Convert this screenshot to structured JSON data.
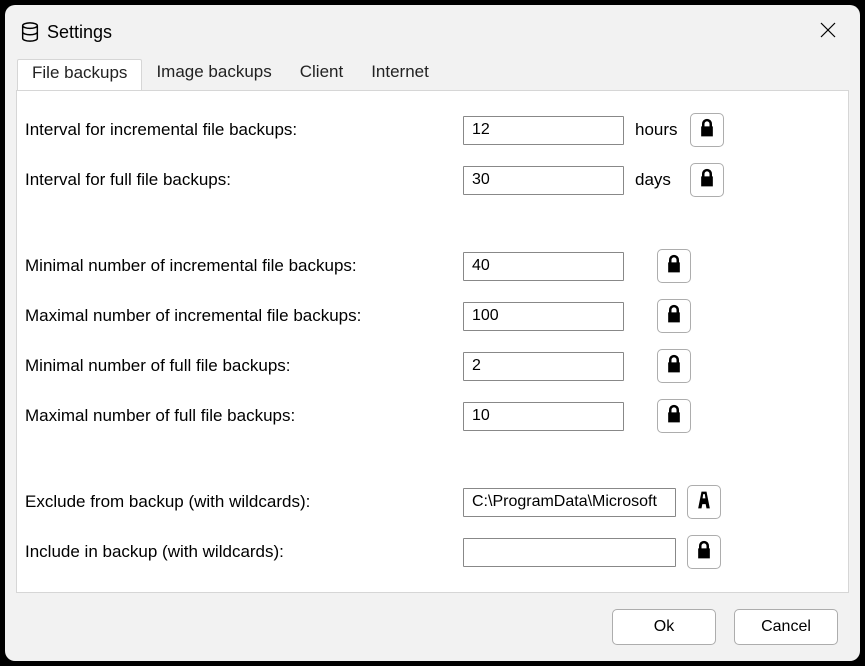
{
  "window": {
    "title": "Settings"
  },
  "tabs": {
    "file_backups": "File backups",
    "image_backups": "Image backups",
    "client": "Client",
    "internet": "Internet"
  },
  "fields": {
    "interval_incremental": {
      "label": "Interval for incremental file backups:",
      "value": "12",
      "unit": "hours"
    },
    "interval_full": {
      "label": "Interval for full file backups:",
      "value": "30",
      "unit": "days"
    },
    "min_incremental": {
      "label": "Minimal number of incremental file backups:",
      "value": "40"
    },
    "max_incremental": {
      "label": "Maximal number of incremental file backups:",
      "value": "100"
    },
    "min_full": {
      "label": "Minimal number of full file backups:",
      "value": "2"
    },
    "max_full": {
      "label": "Maximal number of full file backups:",
      "value": "10"
    },
    "exclude": {
      "label": "Exclude from backup (with wildcards):",
      "value": "C:\\ProgramData\\Microsoft"
    },
    "include": {
      "label": "Include in backup (with wildcards):",
      "value": ""
    }
  },
  "buttons": {
    "ok": "Ok",
    "cancel": "Cancel"
  }
}
